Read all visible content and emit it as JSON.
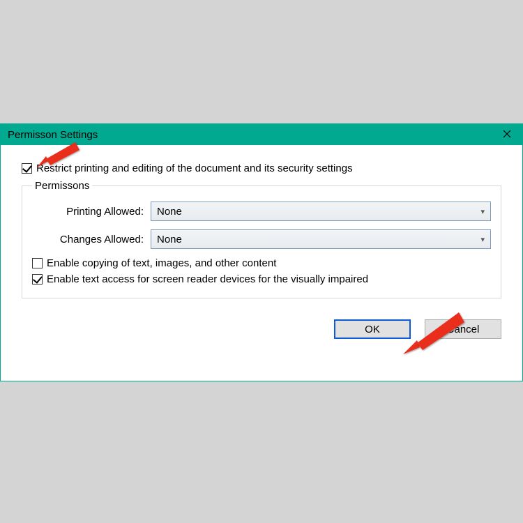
{
  "title": "Permisson Settings",
  "restrict": {
    "checked": true,
    "label": "Restrict printing and editing of the document and its security settings"
  },
  "fieldset_label": "Permissons",
  "printing": {
    "label": "Printing Allowed:",
    "value": "None"
  },
  "changes": {
    "label": "Changes Allowed:",
    "value": "None"
  },
  "enable_copy": {
    "checked": false,
    "label": "Enable copying of text, images, and other content"
  },
  "enable_reader": {
    "checked": true,
    "label": "Enable text access for screen reader devices for the visually impaired"
  },
  "buttons": {
    "ok": "OK",
    "cancel": "Cancel"
  },
  "colors": {
    "accent": "#00a98f",
    "primary_button_border": "#0b5cd8",
    "arrow": "#ea2f1f"
  }
}
